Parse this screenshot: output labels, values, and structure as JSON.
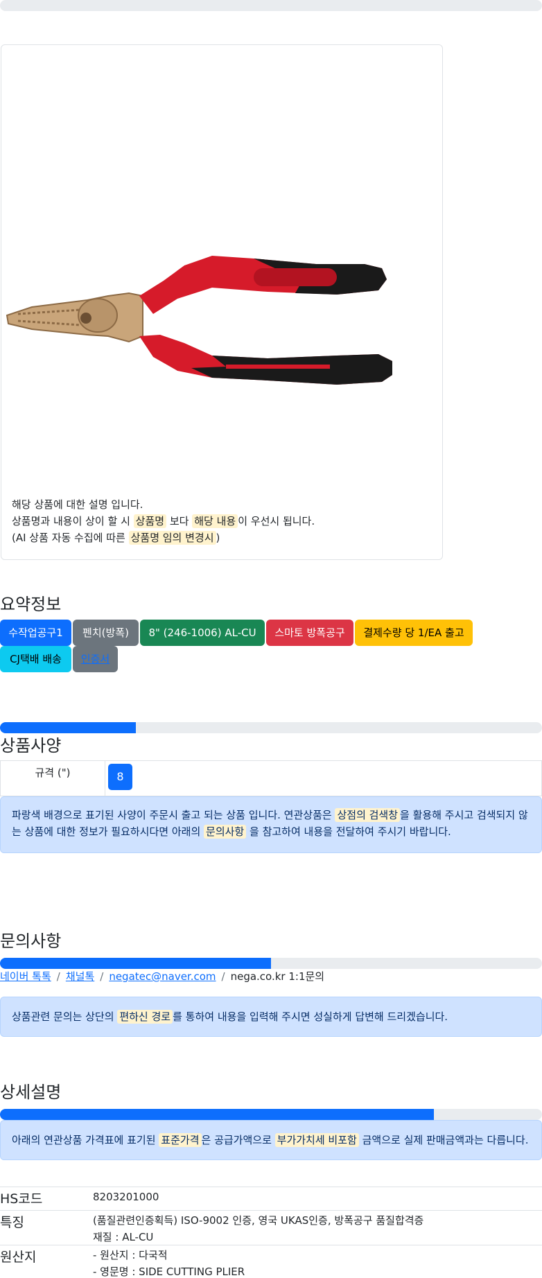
{
  "top_progress": {
    "value": 0
  },
  "product_card": {
    "desc_line1": "해당 상품에 대한 설명 입니다.",
    "desc_line2_a": "상품명과 내용이 상이 할 시",
    "desc_line2_hl1": "상품명",
    "desc_line2_b": "보다",
    "desc_line2_hl2": "해당 내용",
    "desc_line2_c": "이 우선시 됩니다.",
    "desc_line3_a": "(AI 상품 자동 수집에 따른",
    "desc_line3_hl": "상품명 임의 변경시",
    "desc_line3_b": ")"
  },
  "summary": {
    "title": "요약정보",
    "badges": [
      {
        "label": "수작업공구1",
        "style": "primary"
      },
      {
        "label": "펜치(방폭)",
        "style": "secondary"
      },
      {
        "label": "8\" (246-1006) AL-CU",
        "style": "success"
      },
      {
        "label": "스마토 방폭공구",
        "style": "danger"
      },
      {
        "label": "결제수량 당 1/EA 출고",
        "style": "warning"
      },
      {
        "label": "CJ택배 배송",
        "style": "info"
      },
      {
        "label": "인증서",
        "style": "secondary-link"
      }
    ]
  },
  "spec": {
    "progress": 25,
    "title": "상품사양",
    "row_label": "규격 (\")",
    "row_value": "8",
    "notice_a": "파랑색 배경으로 표기된 사양이 주문시 출고 되는 상품 입니다. 연관상품은",
    "notice_hl1": "상점의 검색창",
    "notice_b": "을 활용해 주시고 검색되지 않",
    "notice_c": "는 상품에 대한 정보가 필요하시다면 아래의",
    "notice_hl2": "문의사항",
    "notice_d": "을 참고하여 내용을 전달하여 주시기 바랍니다."
  },
  "inquiry": {
    "title": "문의사항",
    "progress": 50,
    "links": [
      "네이버 톡톡",
      "채널톡",
      "negatec@naver.com"
    ],
    "plain": "nega.co.kr 1:1문의",
    "notice_a": "상품관련 문의는 상단의",
    "notice_hl": "편하신 경로",
    "notice_b": "를 통하여 내용을 입력해 주시면 성실하게 답변해 드리겠습니다."
  },
  "detail": {
    "title": "상세설명",
    "progress": 80,
    "notice_a": "아래의 연관상품 가격표에 표기된",
    "notice_hl1": "표준가격",
    "notice_b": "은 공급가액으로",
    "notice_hl2": "부가가치세 비포함",
    "notice_c": "금액으로 실제 판매금액과는 다릅니다.",
    "rows": [
      {
        "key": "HS코드",
        "values": [
          "8203201000"
        ]
      },
      {
        "key": "특징",
        "values": [
          "(품질관련인증획득) ISO-9002 인증, 영국 UKAS인증, 방폭공구 품질합격증",
          "재질 : AL-CU"
        ]
      },
      {
        "key": "원산지",
        "values": [
          "- 원산지 : 다국적",
          "- 영문명 : SIDE CUTTING PLIER"
        ]
      }
    ]
  },
  "colors": {
    "primary": "#0d6efd",
    "track": "#e9ecef",
    "highlight": "#fff3cd",
    "alert_bg": "#cfe2ff"
  }
}
